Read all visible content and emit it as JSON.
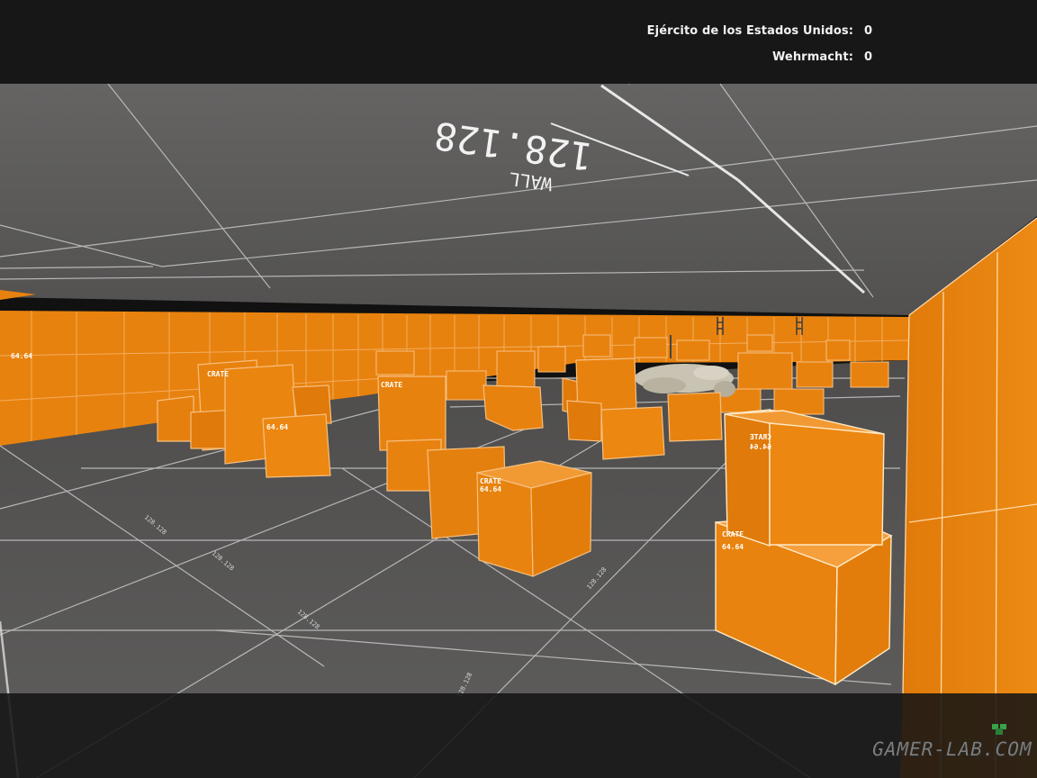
{
  "hud": {
    "scoreboard": [
      {
        "team": "Ejército de los Estados Unidos:",
        "score": "0"
      },
      {
        "team": "Wehrmacht:",
        "score": "0"
      }
    ]
  },
  "world": {
    "ceiling_texture": {
      "line1": "WALL",
      "line2": "128.128"
    },
    "crate_texture": {
      "line1": "CRATE",
      "line2": "64.64"
    },
    "floor_texture": "128.128",
    "colors": {
      "crate": "#e9820f",
      "floor": "#5c5b5a",
      "ceiling": "#5e5d5c",
      "grid": "#c9c9c9"
    }
  },
  "watermark": "GAMER-LAB.COM"
}
